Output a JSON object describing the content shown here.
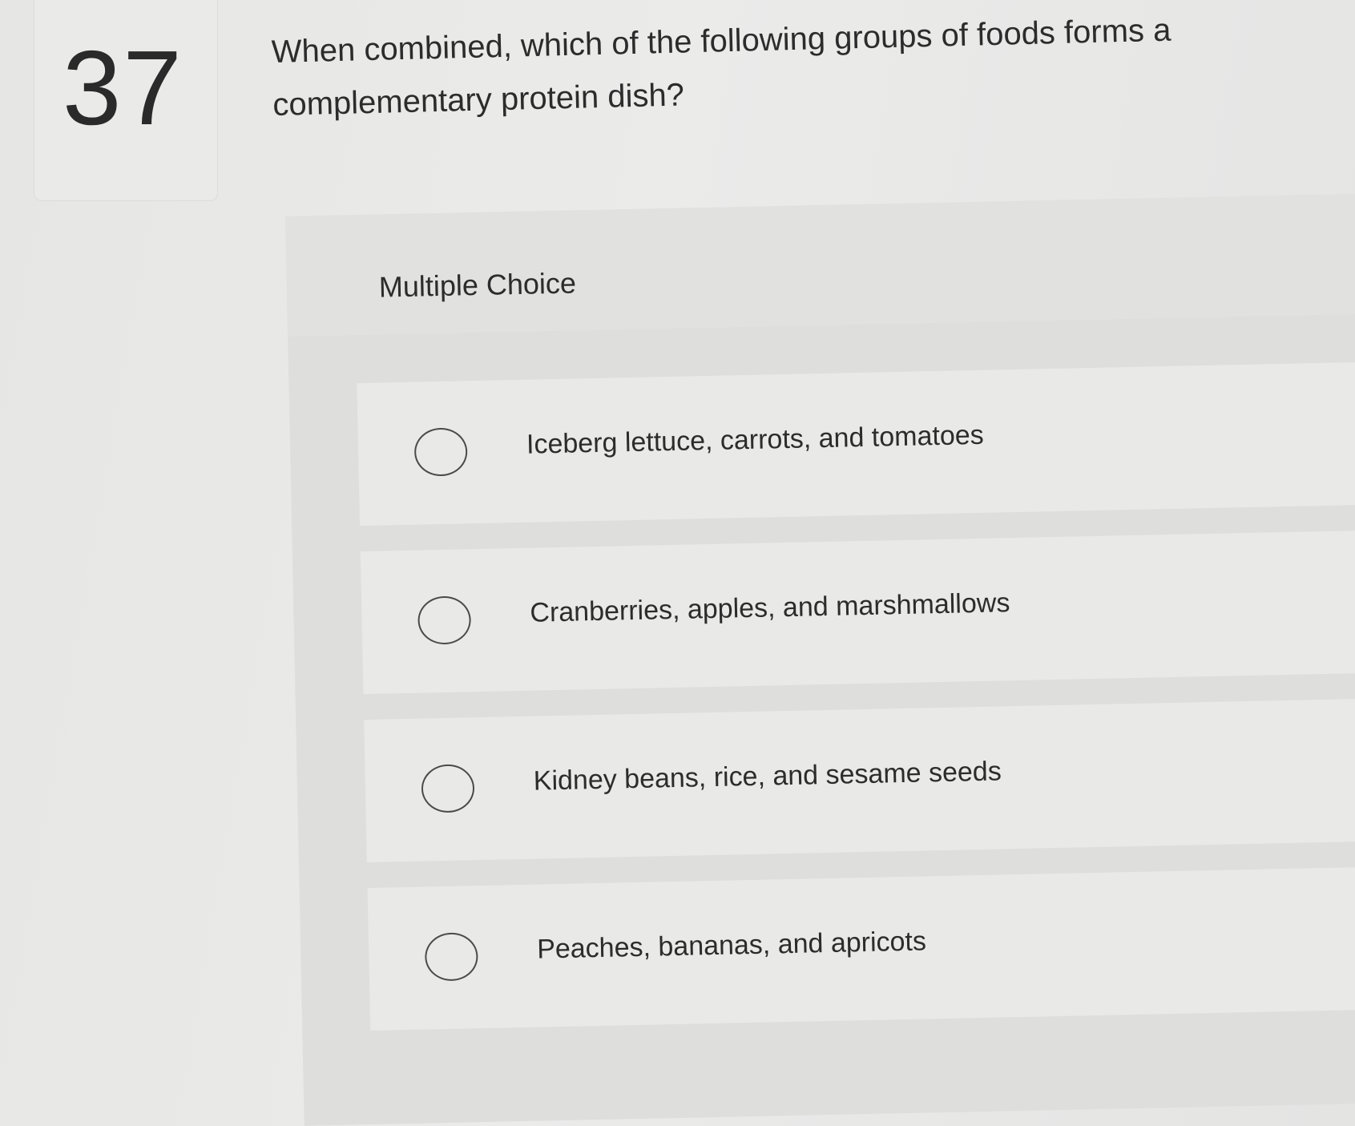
{
  "question": {
    "number": "37",
    "text": "When combined, which of the following groups of foods forms a complementary protein dish?"
  },
  "answer_area": {
    "type_label": "Multiple Choice",
    "options": [
      {
        "label": "Iceberg lettuce, carrots, and tomatoes"
      },
      {
        "label": "Cranberries, apples, and marshmallows"
      },
      {
        "label": "Kidney beans, rice, and sesame seeds"
      },
      {
        "label": "Peaches, bananas, and apricots"
      }
    ]
  }
}
